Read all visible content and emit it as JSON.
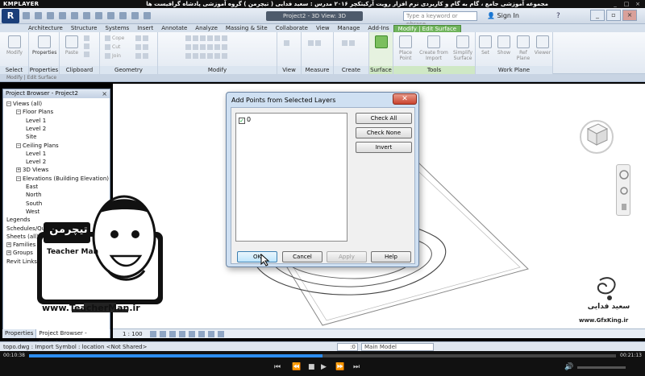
{
  "player": {
    "name": "KMPLAYER",
    "title": "مجموعه آموزشی جامع ، گام به گام و کاربردی نرم افزار رویت آرکیتکچر ۲۰۱۶   مدرس : سعید فدایی ( تیچرمن ) گروه آموزشی پادشاه گرافیست ها",
    "current_time": "00:10:38",
    "total_time": "00:21:13",
    "progress": 0.5
  },
  "revit": {
    "doc_title": "Project2 - 3D View: 3D",
    "search_placeholder": "Type a keyword or phrase",
    "sign_in": "Sign In",
    "tabs": [
      "Architecture",
      "Structure",
      "Systems",
      "Insert",
      "Annotate",
      "Analyze",
      "Massing & Site",
      "Collaborate",
      "View",
      "Manage",
      "Add-Ins",
      "Modify | Edit Surface"
    ],
    "active_tab": "Modify | Edit Surface",
    "panels": [
      {
        "label": "Select",
        "buttons": [
          "Modify"
        ]
      },
      {
        "label": "Properties",
        "buttons": [
          "Properties"
        ]
      },
      {
        "label": "Clipboard",
        "buttons": [
          "Paste"
        ]
      },
      {
        "label": "Geometry",
        "buttons": [
          "Cope",
          "Cut",
          "Join"
        ]
      },
      {
        "label": "Modify",
        "buttons": []
      },
      {
        "label": "View",
        "buttons": []
      },
      {
        "label": "Measure",
        "buttons": []
      },
      {
        "label": "Create",
        "buttons": []
      },
      {
        "label": "Surface",
        "buttons": [
          "Finish Surface"
        ]
      },
      {
        "label": "Tools",
        "buttons": [
          "Place Point",
          "Create from Import",
          "Simplify Surface"
        ]
      },
      {
        "label": "Work Plane",
        "buttons": [
          "Set",
          "Show",
          "Ref Plane",
          "Viewer"
        ]
      }
    ],
    "context_bar": "Modify | Edit Surface",
    "project_browser": {
      "title": "Project Browser - Project2",
      "close": "×",
      "nodes": [
        {
          "label": "Views (all)",
          "level": 0,
          "toggle": "−"
        },
        {
          "label": "Floor Plans",
          "level": 1,
          "toggle": "−"
        },
        {
          "label": "Level 1",
          "level": 2,
          "toggle": ""
        },
        {
          "label": "Level 2",
          "level": 2,
          "toggle": ""
        },
        {
          "label": "Site",
          "level": 2,
          "toggle": ""
        },
        {
          "label": "Ceiling Plans",
          "level": 1,
          "toggle": "−"
        },
        {
          "label": "Level 1",
          "level": 2,
          "toggle": ""
        },
        {
          "label": "Level 2",
          "level": 2,
          "toggle": ""
        },
        {
          "label": "3D Views",
          "level": 1,
          "toggle": "+"
        },
        {
          "label": "Elevations (Building Elevation)",
          "level": 1,
          "toggle": "−"
        },
        {
          "label": "East",
          "level": 2,
          "toggle": ""
        },
        {
          "label": "North",
          "level": 2,
          "toggle": ""
        },
        {
          "label": "South",
          "level": 2,
          "toggle": ""
        },
        {
          "label": "West",
          "level": 2,
          "toggle": ""
        },
        {
          "label": "Legends",
          "level": 0,
          "toggle": ""
        },
        {
          "label": "Schedules/Quantities",
          "level": 0,
          "toggle": ""
        },
        {
          "label": "Sheets (all)",
          "level": 0,
          "toggle": ""
        },
        {
          "label": "Families",
          "level": 0,
          "toggle": "+"
        },
        {
          "label": "Groups",
          "level": 0,
          "toggle": "+"
        },
        {
          "label": "Revit Links",
          "level": 0,
          "toggle": ""
        }
      ]
    },
    "bottom_tabs": [
      "Properties",
      "Project Browser - Project2"
    ],
    "view_scale": "1 : 100",
    "status_text": "topo.dwg : Import Symbol : location <Not Shared>",
    "workset_value": ":0",
    "model_select": "Main Model"
  },
  "dialog": {
    "title": "Add Points from Selected Layers",
    "close": "✕",
    "layers": [
      {
        "name": "0",
        "checked": true
      }
    ],
    "buttons": {
      "check_all": "Check All",
      "check_none": "Check None",
      "invert": "Invert",
      "ok": "OK",
      "cancel": "Cancel",
      "apply": "Apply",
      "help": "Help"
    }
  },
  "overlay": {
    "teacher_logo_text": "تیچرمن",
    "teacher_subtitle": "Teacher Man",
    "teacher_url": "www.TeacherMan.ir",
    "gfx_name": "سعید فدایی",
    "gfx_url": "www.GfxKing.ir"
  },
  "colors": {
    "active_tab": "#6fb35b",
    "ribbon_bg": "#e9eef5",
    "dialog_frame": "#cfe0f2",
    "progress": "#2c8df0"
  }
}
